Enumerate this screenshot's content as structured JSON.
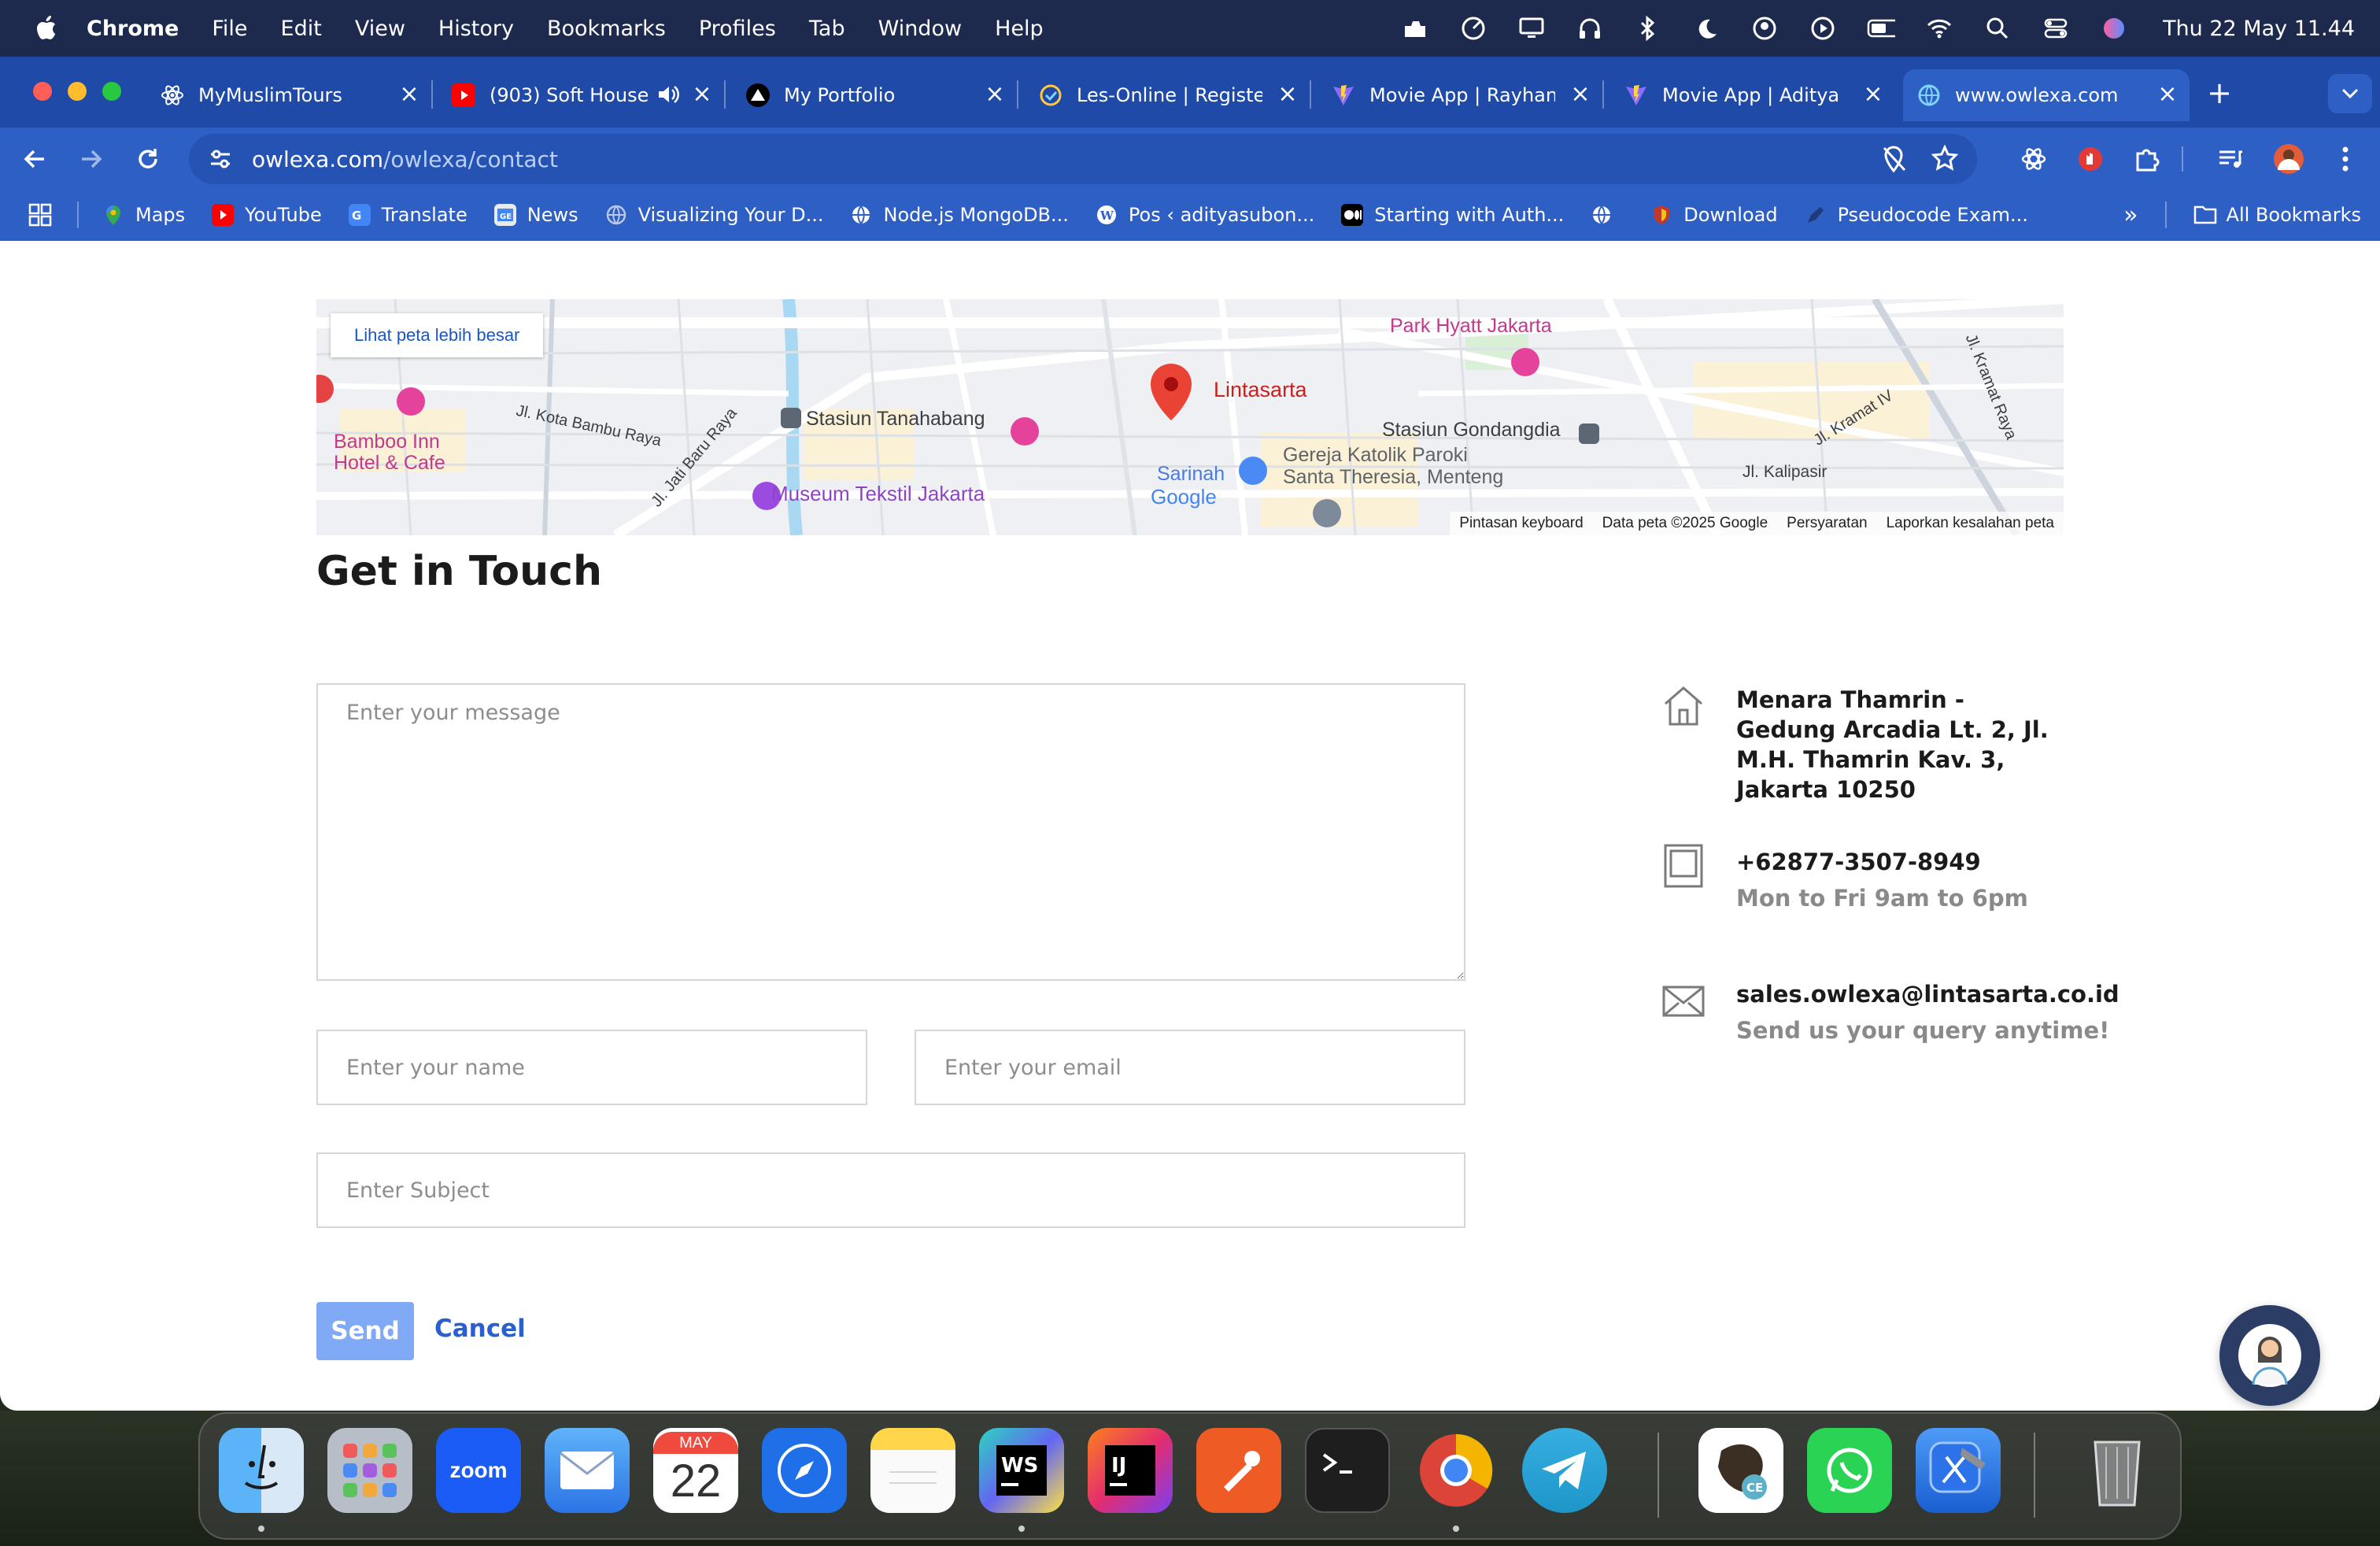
{
  "menubar": {
    "app_name": "Chrome",
    "items": [
      "File",
      "Edit",
      "View",
      "History",
      "Bookmarks",
      "Profiles",
      "Tab",
      "Window",
      "Help"
    ],
    "clock": "Thu 22 May  11.44"
  },
  "tabs": [
    {
      "title": "MyMuslimTours",
      "icon": "react-icon"
    },
    {
      "title": "(903) Soft House",
      "icon": "youtube-icon"
    },
    {
      "title": "My Portfolio",
      "icon": "vercel-icon"
    },
    {
      "title": "Les-Online | Register",
      "icon": "les-online-icon"
    },
    {
      "title": "Movie App | Rayhan",
      "icon": "vite-icon"
    },
    {
      "title": "Movie App | Aditya",
      "icon": "vite-icon"
    },
    {
      "title": "www.owlexa.com",
      "icon": "globe-icon",
      "active": true
    }
  ],
  "address_bar": {
    "domain": "owlexa.com",
    "path": "/owlexa/contact"
  },
  "bookmarks": [
    {
      "label": "Maps",
      "icon": "maps-icon"
    },
    {
      "label": "YouTube",
      "icon": "youtube-icon"
    },
    {
      "label": "Translate",
      "icon": "translate-icon"
    },
    {
      "label": "News",
      "icon": "news-icon"
    },
    {
      "label": "Visualizing Your D...",
      "icon": "globe-icon"
    },
    {
      "label": "Node.js MongoDB...",
      "icon": "globe-icon"
    },
    {
      "label": "Pos ‹ adityasubon...",
      "icon": "wordpress-icon"
    },
    {
      "label": "Starting with Auth...",
      "icon": "medium-icon"
    },
    {
      "label": "",
      "icon": "globe-icon"
    },
    {
      "label": "Download",
      "icon": "shield-icon"
    },
    {
      "label": "Pseudocode Exam...",
      "icon": "pen-icon"
    }
  ],
  "bookmarks_more": "»",
  "all_bookmarks": "All Bookmarks",
  "map": {
    "larger_map_link": "Lihat peta lebih besar",
    "labels": {
      "pin": "Lintasarta",
      "park_hyatt": "Park Hyatt Jakarta",
      "stasiun_tanahabang": "Stasiun Tanahabang",
      "stasiun_gondangdia": "Stasiun Gondangdia",
      "museum": "Museum Tekstil Jakarta",
      "bamboo_inn": "Bamboo Inn\nHotel & Cafe",
      "gereja": "Gereja Katolik Paroki\nSanta Theresia, Menteng",
      "sarinah": "Sarinah",
      "kalipasir": "Jl. Kalipasir",
      "kota_bambu": "Jl. Kota Bambu Raya",
      "jati_baru": "Jl. Jati Baru Raya",
      "kramat_raya": "Jl. Kramat Raya",
      "kramat_iv": "Jl. Kramat IV",
      "google": "Google"
    },
    "footer": [
      "Pintasan keyboard",
      "Data peta ©2025 Google",
      "Persyaratan",
      "Laporkan kesalahan peta"
    ]
  },
  "contact": {
    "heading": "Get in Touch",
    "message_placeholder": "Enter your message",
    "name_placeholder": "Enter your name",
    "email_placeholder": "Enter your email",
    "subject_placeholder": "Enter Subject",
    "send_label": "Send",
    "cancel_label": "Cancel"
  },
  "info": {
    "address": "Menara Thamrin - Gedung Arcadia Lt. 2, Jl. M.H. Thamrin Kav. 3, Jakarta 10250",
    "phone": "+62877-3507-8949",
    "hours": "Mon to Fri 9am to 6pm",
    "email": "sales.owlexa@lintasarta.co.id",
    "email_note": "Send us your query anytime!"
  },
  "dock": [
    "Finder",
    "Launchpad",
    "zoom",
    "Mail",
    "Calendar",
    "Safari",
    "Notes",
    "WebStorm",
    "IntelliJ IDEA",
    "Postman",
    "Terminal",
    "Chrome",
    "Telegram",
    "DBeaver CE",
    "WhatsApp",
    "Xcode",
    "Trash"
  ],
  "calendar": {
    "month": "MAY",
    "day": "22"
  },
  "colors": {
    "accent": "#2e5fc4",
    "tabstrip": "#1f4aa8",
    "send": "#80aaf6",
    "cancel": "#2a5fcc"
  }
}
